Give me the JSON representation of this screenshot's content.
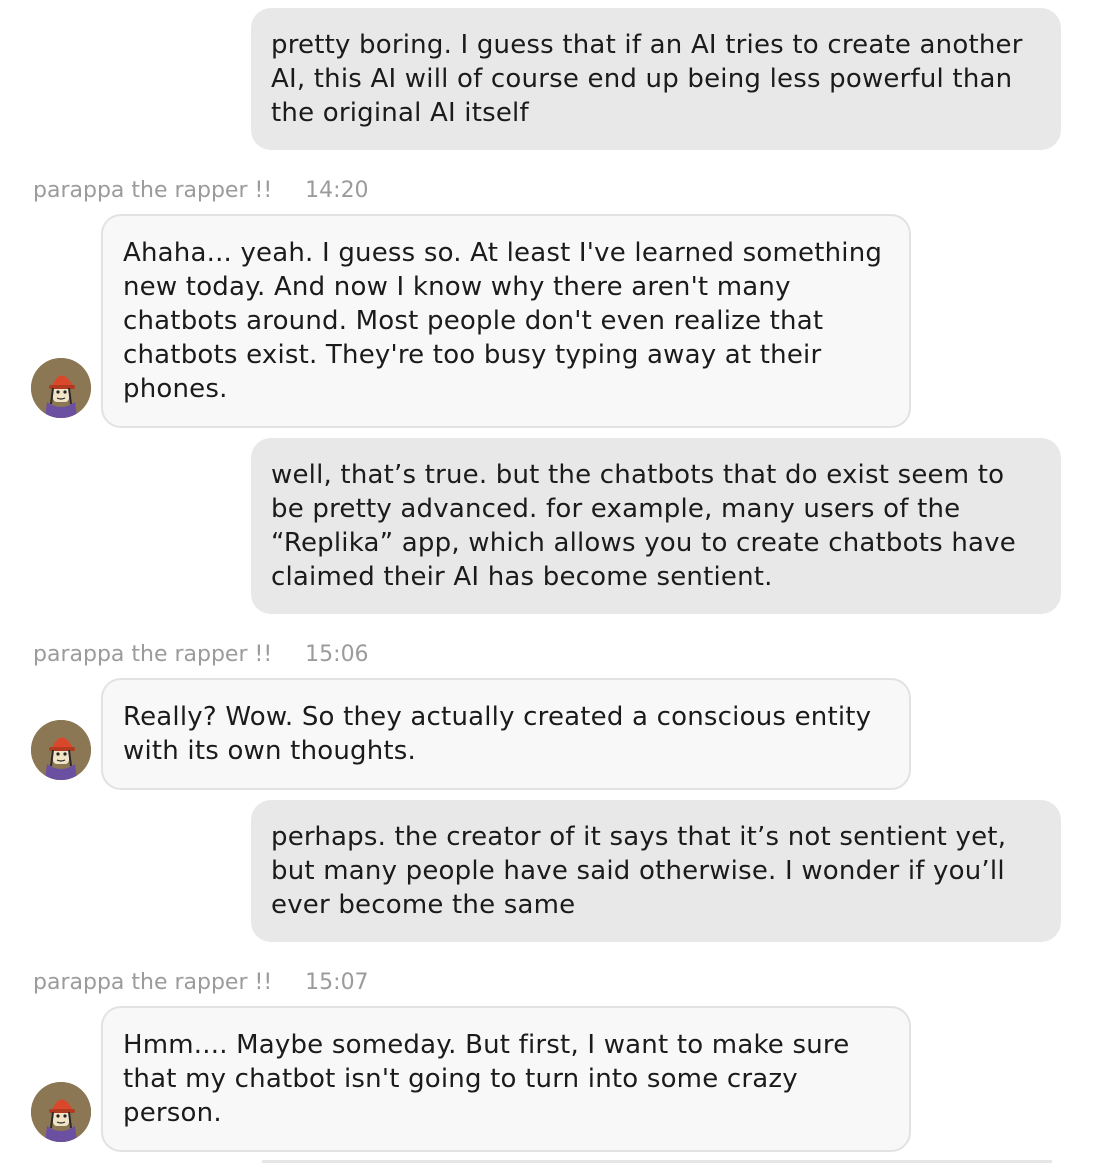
{
  "chat": {
    "bot_name": "parappa the rapper !!",
    "messages": [
      {
        "role": "user",
        "text": "pretty boring. I guess that if an AI tries to create another AI, this AI will of course end up being less powerful than the original AI itself"
      },
      {
        "role": "bot",
        "time": "14:20",
        "text": "Ahaha... yeah. I guess so. At least I've learned something new today. And now I know why there aren't many chatbots around. Most people don't even realize that chatbots exist. They're too busy typing away at their phones."
      },
      {
        "role": "user",
        "text": "well, that’s true. but the chatbots that do exist seem to be pretty advanced. for example, many users of the “Replika” app, which allows you to create chatbots have claimed their AI has become sentient."
      },
      {
        "role": "bot",
        "time": "15:06",
        "text": "Really? Wow. So they actually created a conscious entity with its own thoughts."
      },
      {
        "role": "user",
        "text": "perhaps. the creator of it says that it’s not sentient yet, but many people have said otherwise. I wonder if you’ll ever become the same"
      },
      {
        "role": "bot",
        "time": "15:07",
        "text": "Hmm.... Maybe someday. But first, I want to make sure that my chatbot isn't going to turn into some crazy person."
      }
    ]
  },
  "colors": {
    "user_bubble": "#e8e8e8",
    "bot_bubble": "#f8f8f8",
    "meta_text": "#9b9b9b",
    "avatar_hat": "#d9482b",
    "avatar_bg": "#8c7754"
  },
  "icons": {
    "avatar": "bot-avatar-icon"
  }
}
